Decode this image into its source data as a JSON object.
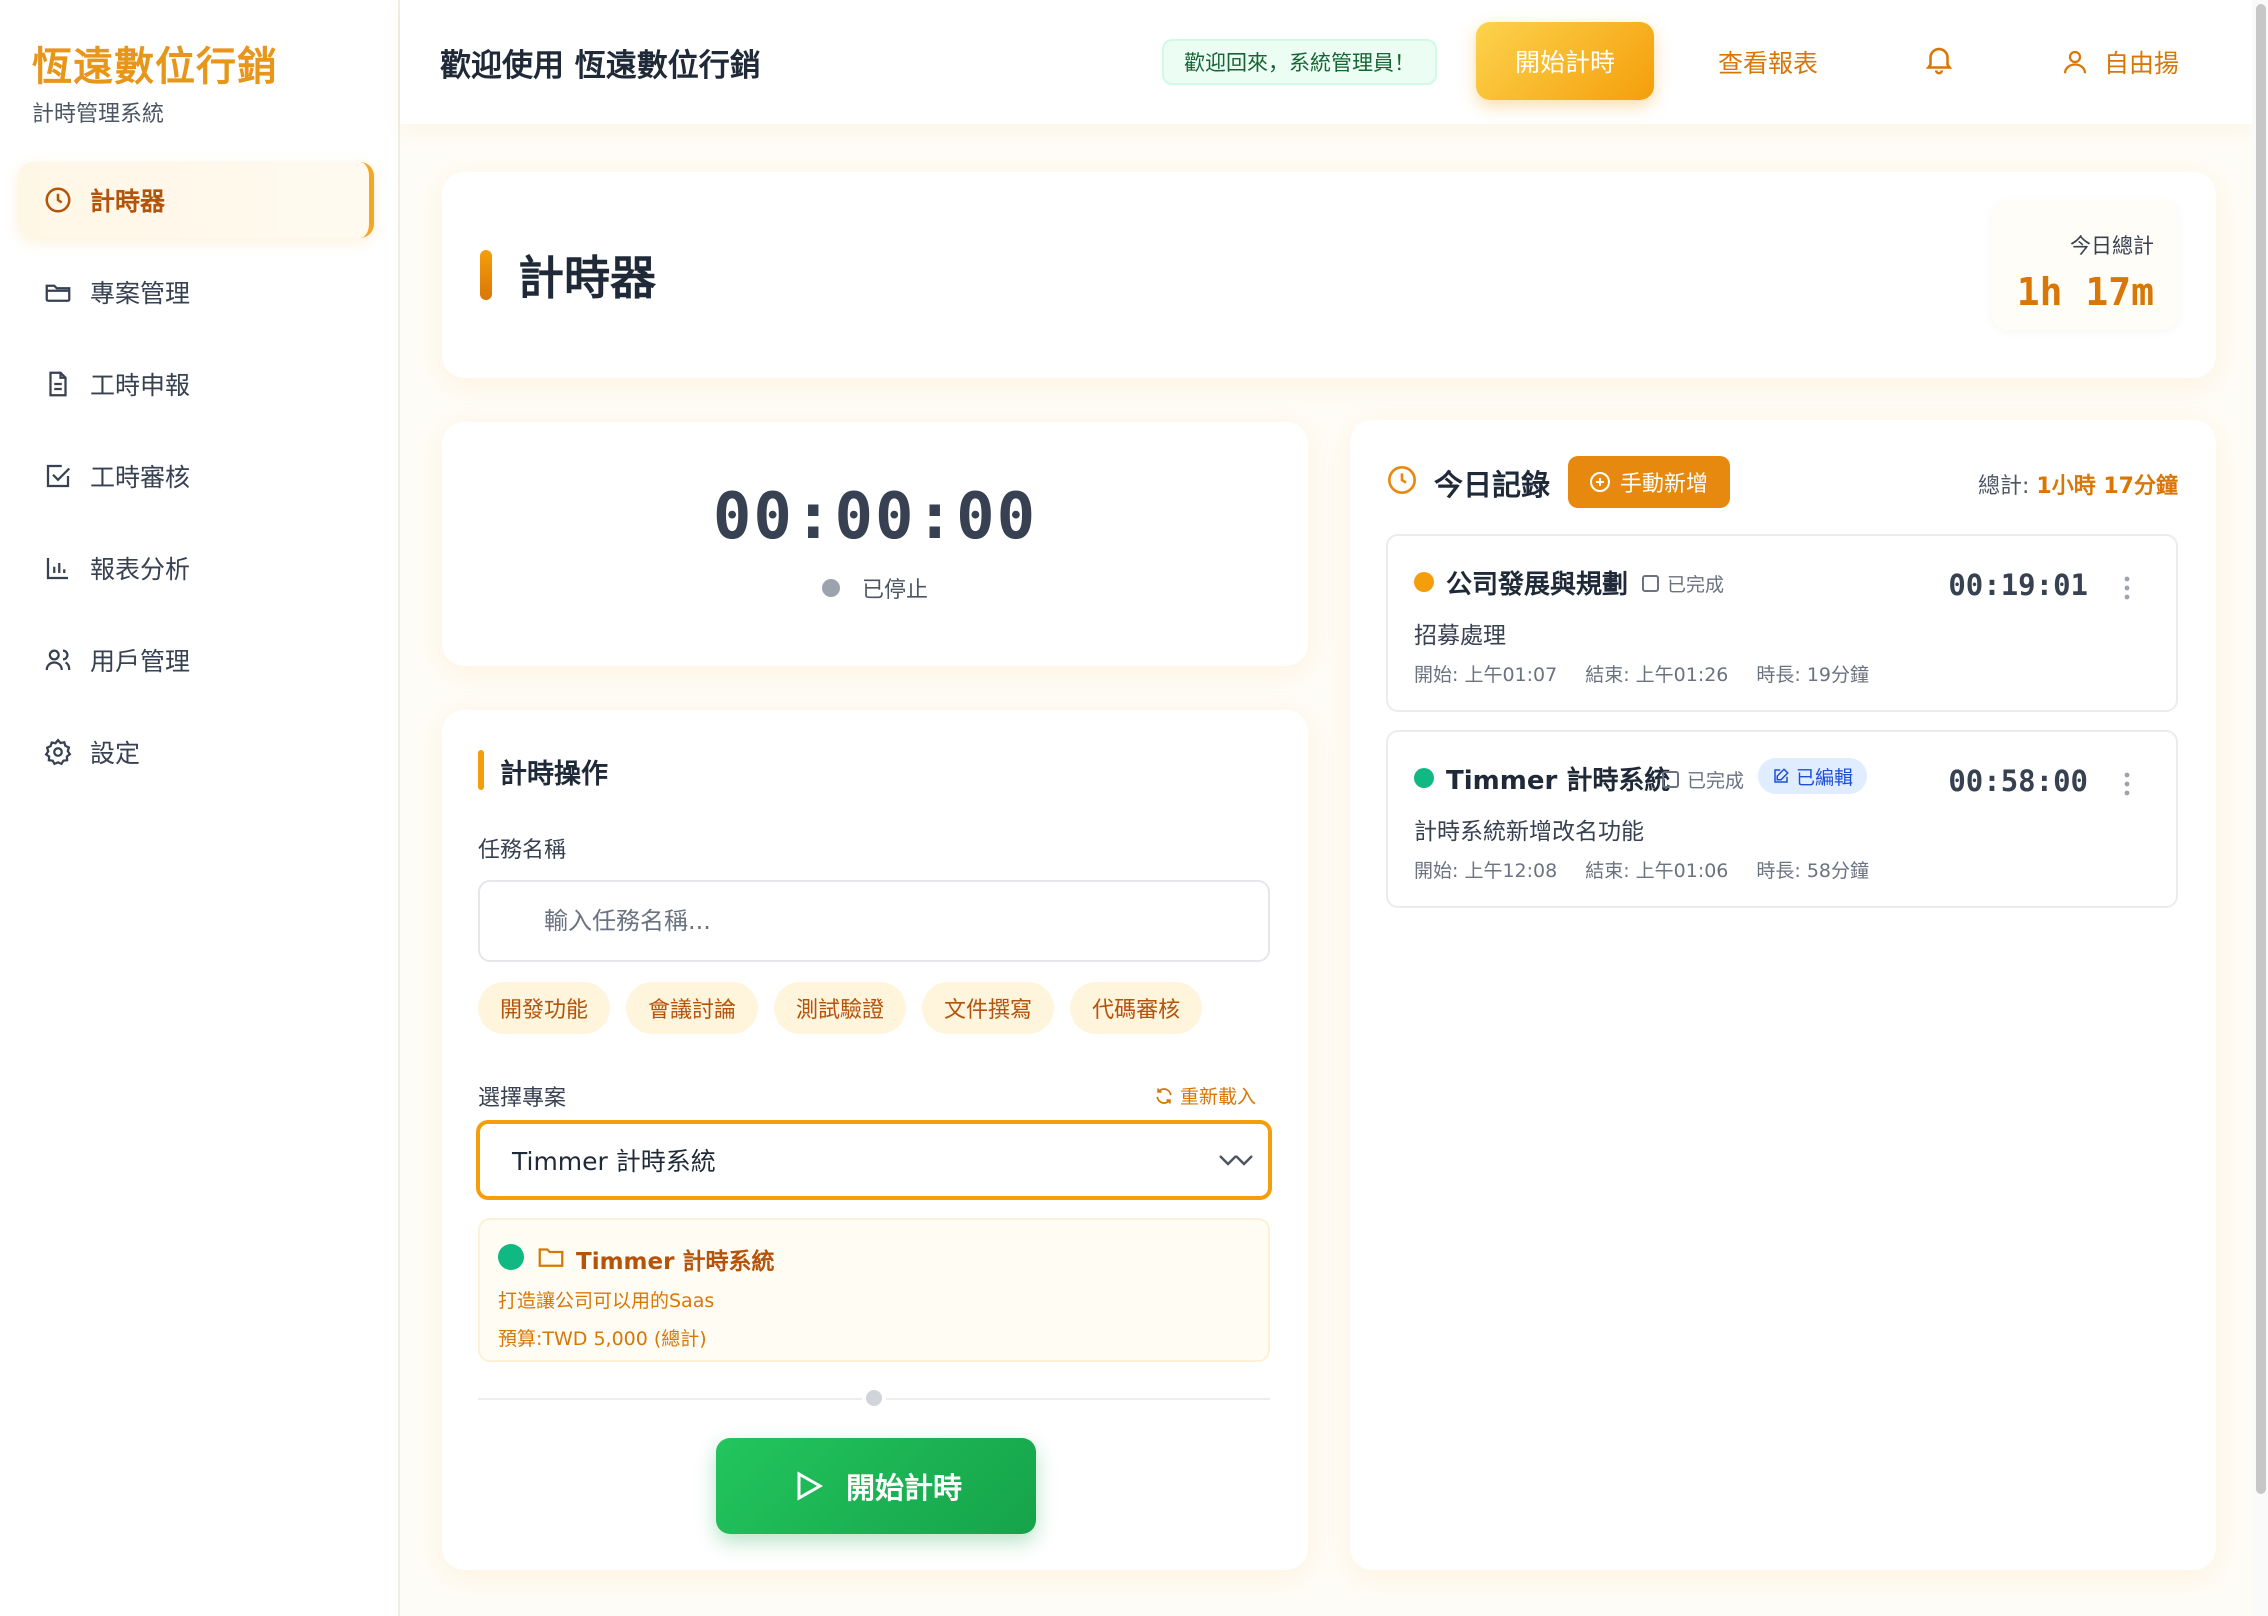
{
  "sidebar": {
    "brand": "恆遠數位行銷",
    "subtitle": "計時管理系統",
    "items": [
      {
        "label": "計時器",
        "icon": "clock-icon"
      },
      {
        "label": "專案管理",
        "icon": "folder-icon"
      },
      {
        "label": "工時申報",
        "icon": "document-icon"
      },
      {
        "label": "工時審核",
        "icon": "checkbox-icon"
      },
      {
        "label": "報表分析",
        "icon": "bar-chart-icon"
      },
      {
        "label": "用戶管理",
        "icon": "users-icon"
      },
      {
        "label": "設定",
        "icon": "gear-icon"
      }
    ]
  },
  "topbar": {
    "title": "歡迎使用 恆遠數位行銷",
    "welcome": "歡迎回來，系統管理員！",
    "start_label": "開始計時",
    "report_label": "查看報表",
    "user_name": "自由揚"
  },
  "header": {
    "title": "計時器",
    "today_label": "今日總計",
    "today_value": "1h 17m"
  },
  "timer": {
    "display": "00:00:00",
    "status": "已停止"
  },
  "ops": {
    "title": "計時操作",
    "task_label": "任務名稱",
    "task_placeholder": "輸入任務名稱...",
    "task_value": "",
    "chips": [
      "開發功能",
      "會議討論",
      "測試驗證",
      "文件撰寫",
      "代碼審核"
    ],
    "project_label": "選擇專案",
    "reload_label": "重新載入",
    "selected_project": "Timmer 計時系統",
    "project_info": {
      "name": "Timmer 計時系統",
      "description": "打造讓公司可以用的Saas",
      "budget": "預算:TWD 5,000 (總計)"
    },
    "start_label": "開始計時"
  },
  "records": {
    "title": "今日記錄",
    "add_label": "手動新增",
    "total_label": "總計: ",
    "total_value": "1小時 17分鐘",
    "items": [
      {
        "project": "公司發展與規劃",
        "done_label": "已完成",
        "edited_label": "",
        "time": "00:19:01",
        "description": "招募處理",
        "start": "開始: 上午01:07",
        "end": "結束: 上午01:26",
        "duration": "時長: 19分鐘",
        "color": "#f59e0b"
      },
      {
        "project": "Timmer 計時系統",
        "done_label": "已完成",
        "edited_label": "已編輯",
        "time": "00:58:00",
        "description": "計時系統新增改名功能",
        "start": "開始: 上午12:08",
        "end": "結束: 上午01:06",
        "duration": "時長: 58分鐘",
        "color": "#10b981"
      }
    ]
  },
  "colors": {
    "accent": "#f59e0b",
    "brand": "#e8961a",
    "success": "#16a34a"
  }
}
